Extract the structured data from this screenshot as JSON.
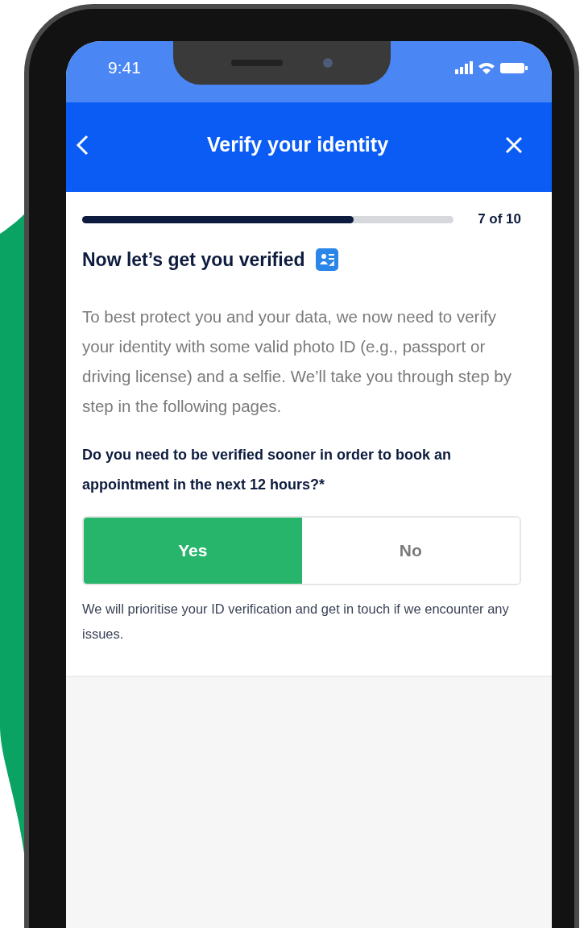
{
  "status_bar": {
    "time": "9:41"
  },
  "header": {
    "title": "Verify your identity"
  },
  "progress": {
    "level": 0.73,
    "label": "7 of 10"
  },
  "heading": "Now let’s get you verified",
  "intro": "To best protect you and your data, we now need to verify your identity with some valid photo ID (e.g., passport or driving license) and a selfie. We’ll take you through step by step in the following pages.",
  "question": "Do you need to be verified sooner in order to book an appointment in the next 12 hours?*",
  "options": [
    {
      "label": "Yes",
      "selected": true
    },
    {
      "label": "No",
      "selected": false
    }
  ],
  "note": "We will prioritise your ID verification and get in touch if we encounter any issues."
}
